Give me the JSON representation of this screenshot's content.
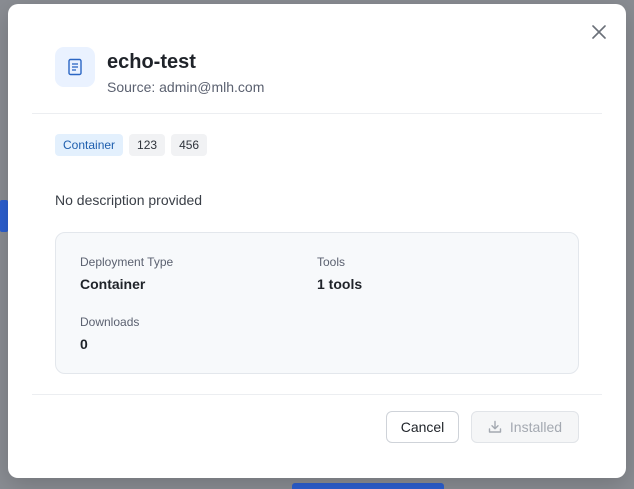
{
  "dialog": {
    "title": "echo-test",
    "source": "Source: admin@mlh.com",
    "tags": [
      "Container",
      "123",
      "456"
    ],
    "description": "No description provided",
    "details": {
      "deployment_type_label": "Deployment Type",
      "deployment_type_value": "Container",
      "tools_label": "Tools",
      "tools_value": "1 tools",
      "downloads_label": "Downloads",
      "downloads_value": "0"
    },
    "buttons": {
      "cancel": "Cancel",
      "installed": "Installed"
    },
    "icons": {
      "header": "document-server-icon",
      "close": "close-icon",
      "installed": "download-icon"
    },
    "colors": {
      "accent": "#1f5fae",
      "icon_bg": "#eaf2ff",
      "tag_primary_bg": "#e3f0fd"
    }
  }
}
